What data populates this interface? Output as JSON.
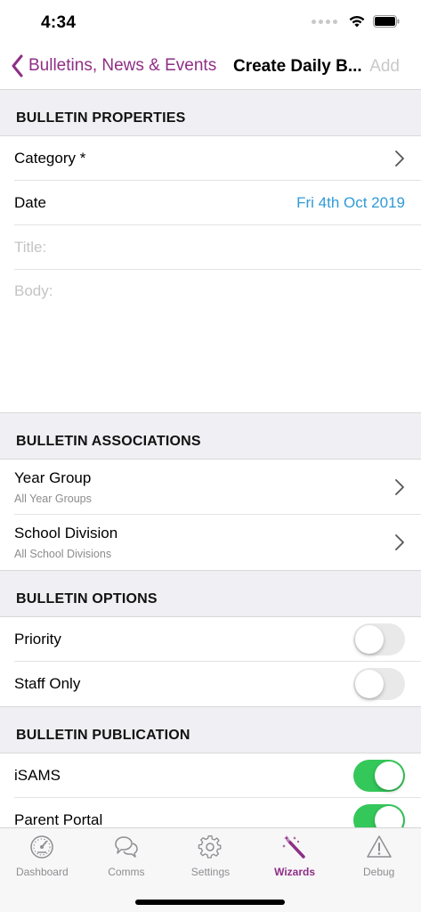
{
  "status": {
    "time": "4:34"
  },
  "nav": {
    "back_label": "Bulletins, News & Events",
    "title": "Create Daily B...",
    "add_label": "Add"
  },
  "sections": {
    "properties": {
      "header": "BULLETIN PROPERTIES",
      "category_label": "Category *",
      "date_label": "Date",
      "date_value": "Fri 4th Oct 2019",
      "title_placeholder": "Title:",
      "body_placeholder": "Body:"
    },
    "associations": {
      "header": "BULLETIN ASSOCIATIONS",
      "year_group_label": "Year Group",
      "year_group_value": "All Year Groups",
      "division_label": "School Division",
      "division_value": "All School Divisions"
    },
    "options": {
      "header": "BULLETIN OPTIONS",
      "priority_label": "Priority",
      "priority_on": false,
      "staff_only_label": "Staff Only",
      "staff_only_on": false
    },
    "publication": {
      "header": "BULLETIN PUBLICATION",
      "isams_label": "iSAMS",
      "isams_on": true,
      "parent_portal_label": "Parent Portal",
      "parent_portal_on": true
    }
  },
  "tabs": [
    {
      "label": "Dashboard",
      "icon": "dashboard-gauge-icon"
    },
    {
      "label": "Comms",
      "icon": "chat-bubbles-icon"
    },
    {
      "label": "Settings",
      "icon": "gear-icon"
    },
    {
      "label": "Wizards",
      "icon": "magic-wand-icon",
      "active": true
    },
    {
      "label": "Debug",
      "icon": "warning-triangle-icon"
    }
  ],
  "colors": {
    "accent": "#8e2f86",
    "date_blue": "#2f9bd6",
    "toggle_on": "#34c759",
    "toggle_off": "#e9e9ea"
  }
}
